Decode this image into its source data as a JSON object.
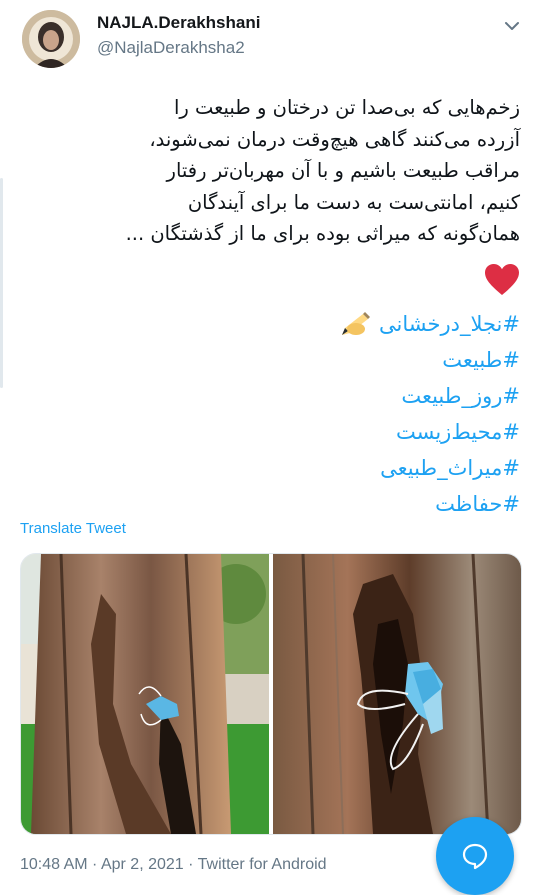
{
  "author": {
    "display_name": "NAJLA.Derakhshani",
    "handle": "@NajlaDerakhsha2"
  },
  "tweet": {
    "lines": [
      "زخم‌هایی که بی‌صدا تن درختان و طبیعت را",
      "آزرده می‌کنند گاهی هیچ‌وقت درمان نمی‌شوند،",
      "مراقب طبیعت باشیم و با آن مهربان‌تر رفتار",
      "کنیم، امانتی‌ست به دست ما برای آیندگان",
      "همان‌گونه که میراثی بوده برای ما از گذشتگان ..."
    ],
    "heart_emoji": "red-heart",
    "hashtags": [
      "#نجلا_درخشانی",
      "#طبیعت",
      "#روز_طبیعت",
      "#محیط‌زیست",
      "#میراث_طبیعی",
      "#حفاظت"
    ],
    "first_hashtag_emoji": "writing-hand",
    "translate_label": "Translate Tweet"
  },
  "meta": {
    "time": "10:48 AM",
    "date": "Apr 2, 2021",
    "source": "Twitter for Android",
    "separator": " · "
  },
  "colors": {
    "link": "#1da1f2",
    "secondary_text": "#657786",
    "primary_text": "#0f1419",
    "fab": "#1da1f2"
  }
}
